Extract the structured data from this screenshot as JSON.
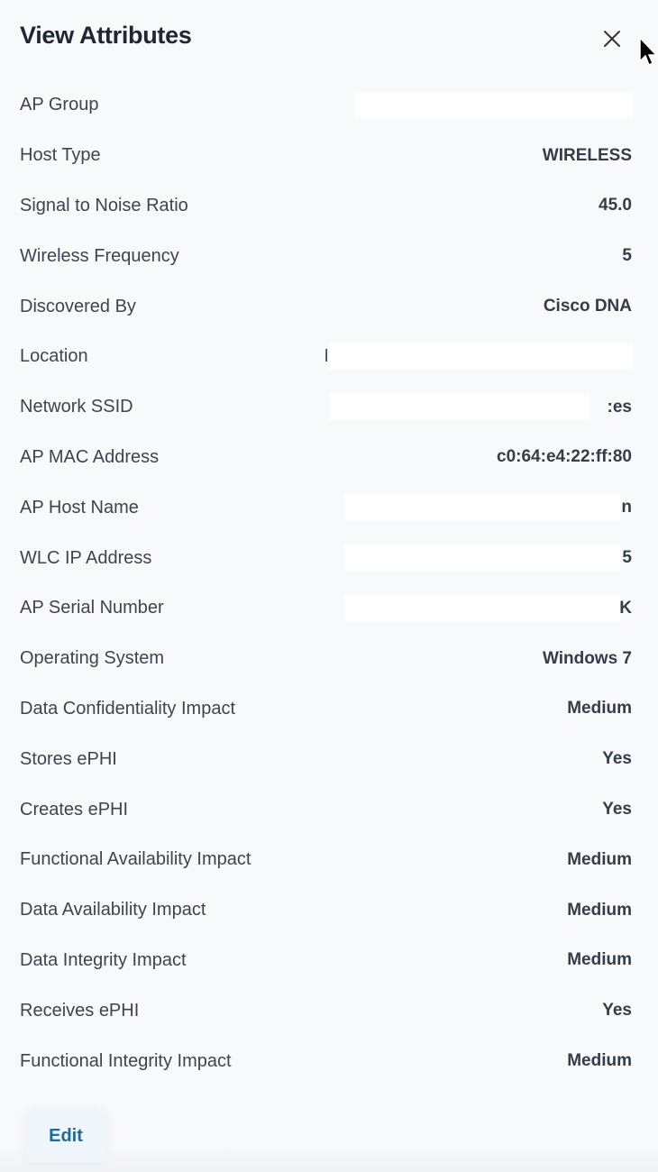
{
  "header": {
    "title": "View Attributes",
    "close_icon": "close-icon"
  },
  "attributes": [
    {
      "label": "AP Group",
      "value": "",
      "redacted": true
    },
    {
      "label": "Host Type",
      "value": "WIRELESS"
    },
    {
      "label": "Signal to Noise Ratio",
      "value": "45.0"
    },
    {
      "label": "Wireless Frequency",
      "value": "5"
    },
    {
      "label": "Discovered By",
      "value": "Cisco DNA"
    },
    {
      "label": "Location",
      "value": "l",
      "redacted": true
    },
    {
      "label": "Network SSID",
      "value": ":es",
      "redacted": true
    },
    {
      "label": "AP MAC Address",
      "value": "c0:64:e4:22:ff:80"
    },
    {
      "label": "AP Host Name",
      "value": "n",
      "redacted": true
    },
    {
      "label": "WLC IP Address",
      "value": "5",
      "redacted": true
    },
    {
      "label": "AP Serial Number",
      "value": "K",
      "redacted": true
    },
    {
      "label": "Operating System",
      "value": "Windows 7"
    },
    {
      "label": "Data Confidentiality Impact",
      "value": "Medium"
    },
    {
      "label": "Stores ePHI",
      "value": "Yes"
    },
    {
      "label": "Creates ePHI",
      "value": "Yes"
    },
    {
      "label": "Functional Availability Impact",
      "value": "Medium"
    },
    {
      "label": "Data Availability Impact",
      "value": "Medium"
    },
    {
      "label": "Data Integrity Impact",
      "value": "Medium"
    },
    {
      "label": "Receives ePHI",
      "value": "Yes"
    },
    {
      "label": "Functional Integrity Impact",
      "value": "Medium"
    }
  ],
  "footer": {
    "edit_label": "Edit"
  },
  "colors": {
    "accent": "#1d6aa0",
    "background": "#f8f9fa"
  }
}
